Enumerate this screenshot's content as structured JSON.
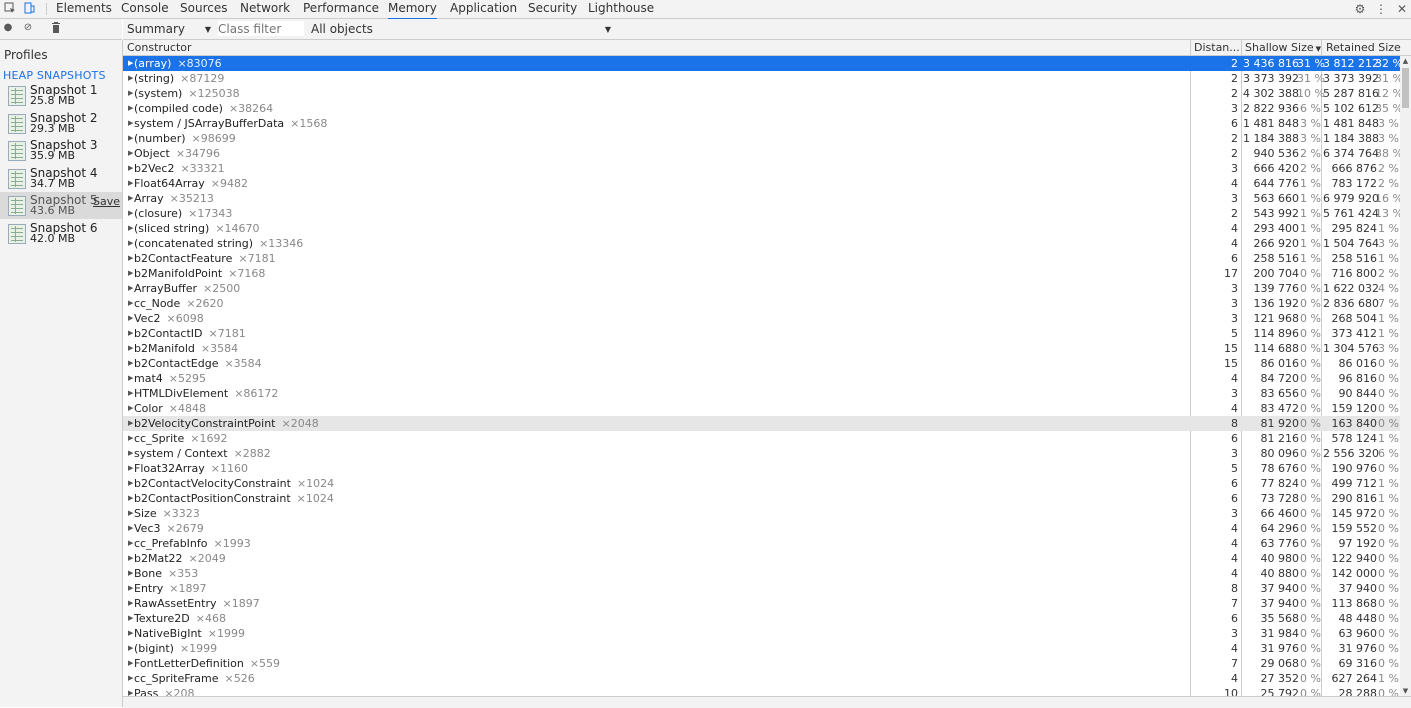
{
  "tabs": {
    "items": [
      "Elements",
      "Console",
      "Sources",
      "Network",
      "Performance",
      "Memory",
      "Application",
      "Security",
      "Lighthouse"
    ],
    "active_index": 5
  },
  "icons": {
    "inspect": "inspect-element-icon",
    "device": "device-toolbar-icon",
    "settings": "gear-icon",
    "more": "kebab-menu-icon",
    "close": "close-icon",
    "record": "record-icon",
    "clear": "clear-icon",
    "trash": "trash-icon"
  },
  "toolbar": {
    "view": "Summary",
    "class_filter_placeholder": "Class filter",
    "objects": "All objects"
  },
  "sidebar": {
    "title": "Profiles",
    "section": "HEAP SNAPSHOTS",
    "snapshots": [
      {
        "name": "Snapshot 1",
        "size": "25.8 MB"
      },
      {
        "name": "Snapshot 2",
        "size": "29.3 MB"
      },
      {
        "name": "Snapshot 3",
        "size": "35.9 MB"
      },
      {
        "name": "Snapshot 4",
        "size": "34.7 MB"
      },
      {
        "name": "Snapshot 5",
        "size": "43.6 MB",
        "save": "Save"
      },
      {
        "name": "Snapshot 6",
        "size": "42.0 MB"
      }
    ],
    "selected_index": 4
  },
  "grid": {
    "headers": {
      "constructor": "Constructor",
      "distance": "Distan...",
      "shallow": "Shallow Size",
      "retained": "Retained Size"
    },
    "sorted_column": "shallow",
    "selected_row": 0,
    "hovered_row": 24,
    "rows": [
      {
        "name": "(array)",
        "count": "×83076",
        "dist": "2",
        "shallow": "3 436 816",
        "spct": "31 %",
        "retained": "3 812 212",
        "rpct": "32 %"
      },
      {
        "name": "(string)",
        "count": "×87129",
        "dist": "2",
        "shallow": "3 373 392",
        "spct": "31 %",
        "retained": "3 373 392",
        "rpct": "31 %"
      },
      {
        "name": "(system)",
        "count": "×125038",
        "dist": "2",
        "shallow": "4 302 388",
        "spct": "10 %",
        "retained": "5 287 816",
        "rpct": "12 %"
      },
      {
        "name": "(compiled code)",
        "count": "×38264",
        "dist": "3",
        "shallow": "2 822 936",
        "spct": "6 %",
        "retained": "5 102 612",
        "rpct": "35 %"
      },
      {
        "name": "system / JSArrayBufferData",
        "count": "×1568",
        "dist": "6",
        "shallow": "1 481 848",
        "spct": "3 %",
        "retained": "1 481 848",
        "rpct": "3 %"
      },
      {
        "name": "(number)",
        "count": "×98699",
        "dist": "2",
        "shallow": "1 184 388",
        "spct": "3 %",
        "retained": "1 184 388",
        "rpct": "3 %"
      },
      {
        "name": "Object",
        "count": "×34796",
        "dist": "2",
        "shallow": "940 536",
        "spct": "2 %",
        "retained": "6 374 764",
        "rpct": "38 %"
      },
      {
        "name": "b2Vec2",
        "count": "×33321",
        "dist": "3",
        "shallow": "666 420",
        "spct": "2 %",
        "retained": "666 876",
        "rpct": "2 %"
      },
      {
        "name": "Float64Array",
        "count": "×9482",
        "dist": "4",
        "shallow": "644 776",
        "spct": "1 %",
        "retained": "783 172",
        "rpct": "2 %"
      },
      {
        "name": "Array",
        "count": "×35213",
        "dist": "3",
        "shallow": "563 660",
        "spct": "1 %",
        "retained": "6 979 920",
        "rpct": "16 %"
      },
      {
        "name": "(closure)",
        "count": "×17343",
        "dist": "2",
        "shallow": "543 992",
        "spct": "1 %",
        "retained": "5 761 424",
        "rpct": "13 %"
      },
      {
        "name": "(sliced string)",
        "count": "×14670",
        "dist": "4",
        "shallow": "293 400",
        "spct": "1 %",
        "retained": "295 824",
        "rpct": "1 %"
      },
      {
        "name": "(concatenated string)",
        "count": "×13346",
        "dist": "4",
        "shallow": "266 920",
        "spct": "1 %",
        "retained": "1 504 764",
        "rpct": "3 %"
      },
      {
        "name": "b2ContactFeature",
        "count": "×7181",
        "dist": "6",
        "shallow": "258 516",
        "spct": "1 %",
        "retained": "258 516",
        "rpct": "1 %"
      },
      {
        "name": "b2ManifoldPoint",
        "count": "×7168",
        "dist": "17",
        "shallow": "200 704",
        "spct": "0 %",
        "retained": "716 800",
        "rpct": "2 %"
      },
      {
        "name": "ArrayBuffer",
        "count": "×2500",
        "dist": "3",
        "shallow": "139 776",
        "spct": "0 %",
        "retained": "1 622 032",
        "rpct": "4 %"
      },
      {
        "name": "cc_Node",
        "count": "×2620",
        "dist": "3",
        "shallow": "136 192",
        "spct": "0 %",
        "retained": "2 836 680",
        "rpct": "7 %"
      },
      {
        "name": "Vec2",
        "count": "×6098",
        "dist": "3",
        "shallow": "121 968",
        "spct": "0 %",
        "retained": "268 504",
        "rpct": "1 %"
      },
      {
        "name": "b2ContactID",
        "count": "×7181",
        "dist": "5",
        "shallow": "114 896",
        "spct": "0 %",
        "retained": "373 412",
        "rpct": "1 %"
      },
      {
        "name": "b2Manifold",
        "count": "×3584",
        "dist": "15",
        "shallow": "114 688",
        "spct": "0 %",
        "retained": "1 304 576",
        "rpct": "3 %"
      },
      {
        "name": "b2ContactEdge",
        "count": "×3584",
        "dist": "15",
        "shallow": "86 016",
        "spct": "0 %",
        "retained": "86 016",
        "rpct": "0 %"
      },
      {
        "name": "mat4",
        "count": "×5295",
        "dist": "4",
        "shallow": "84 720",
        "spct": "0 %",
        "retained": "96 816",
        "rpct": "0 %"
      },
      {
        "name": "HTMLDivElement",
        "count": "×86172",
        "dist": "3",
        "shallow": "83 656",
        "spct": "0 %",
        "retained": "90 844",
        "rpct": "0 %"
      },
      {
        "name": "Color",
        "count": "×4848",
        "dist": "4",
        "shallow": "83 472",
        "spct": "0 %",
        "retained": "159 120",
        "rpct": "0 %"
      },
      {
        "name": "b2VelocityConstraintPoint",
        "count": "×2048",
        "dist": "8",
        "shallow": "81 920",
        "spct": "0 %",
        "retained": "163 840",
        "rpct": "0 %"
      },
      {
        "name": "cc_Sprite",
        "count": "×1692",
        "dist": "6",
        "shallow": "81 216",
        "spct": "0 %",
        "retained": "578 124",
        "rpct": "1 %"
      },
      {
        "name": "system / Context",
        "count": "×2882",
        "dist": "3",
        "shallow": "80 096",
        "spct": "0 %",
        "retained": "2 556 320",
        "rpct": "6 %"
      },
      {
        "name": "Float32Array",
        "count": "×1160",
        "dist": "5",
        "shallow": "78 676",
        "spct": "0 %",
        "retained": "190 976",
        "rpct": "0 %"
      },
      {
        "name": "b2ContactVelocityConstraint",
        "count": "×1024",
        "dist": "6",
        "shallow": "77 824",
        "spct": "0 %",
        "retained": "499 712",
        "rpct": "1 %"
      },
      {
        "name": "b2ContactPositionConstraint",
        "count": "×1024",
        "dist": "6",
        "shallow": "73 728",
        "spct": "0 %",
        "retained": "290 816",
        "rpct": "1 %"
      },
      {
        "name": "Size",
        "count": "×3323",
        "dist": "3",
        "shallow": "66 460",
        "spct": "0 %",
        "retained": "145 972",
        "rpct": "0 %"
      },
      {
        "name": "Vec3",
        "count": "×2679",
        "dist": "4",
        "shallow": "64 296",
        "spct": "0 %",
        "retained": "159 552",
        "rpct": "0 %"
      },
      {
        "name": "cc_PrefabInfo",
        "count": "×1993",
        "dist": "4",
        "shallow": "63 776",
        "spct": "0 %",
        "retained": "97 192",
        "rpct": "0 %"
      },
      {
        "name": "b2Mat22",
        "count": "×2049",
        "dist": "4",
        "shallow": "40 980",
        "spct": "0 %",
        "retained": "122 940",
        "rpct": "0 %"
      },
      {
        "name": "Bone",
        "count": "×353",
        "dist": "4",
        "shallow": "40 880",
        "spct": "0 %",
        "retained": "142 000",
        "rpct": "0 %"
      },
      {
        "name": "Entry",
        "count": "×1897",
        "dist": "8",
        "shallow": "37 940",
        "spct": "0 %",
        "retained": "37 940",
        "rpct": "0 %"
      },
      {
        "name": "RawAssetEntry",
        "count": "×1897",
        "dist": "7",
        "shallow": "37 940",
        "spct": "0 %",
        "retained": "113 868",
        "rpct": "0 %"
      },
      {
        "name": "Texture2D",
        "count": "×468",
        "dist": "6",
        "shallow": "35 568",
        "spct": "0 %",
        "retained": "48 448",
        "rpct": "0 %"
      },
      {
        "name": "NativeBigInt",
        "count": "×1999",
        "dist": "3",
        "shallow": "31 984",
        "spct": "0 %",
        "retained": "63 960",
        "rpct": "0 %"
      },
      {
        "name": "(bigint)",
        "count": "×1999",
        "dist": "4",
        "shallow": "31 976",
        "spct": "0 %",
        "retained": "31 976",
        "rpct": "0 %"
      },
      {
        "name": "FontLetterDefinition",
        "count": "×559",
        "dist": "7",
        "shallow": "29 068",
        "spct": "0 %",
        "retained": "69 316",
        "rpct": "0 %"
      },
      {
        "name": "cc_SpriteFrame",
        "count": "×526",
        "dist": "4",
        "shallow": "27 352",
        "spct": "0 %",
        "retained": "627 264",
        "rpct": "1 %"
      },
      {
        "name": "Pass",
        "count": "×208",
        "dist": "10",
        "shallow": "25 792",
        "spct": "0 %",
        "retained": "28 288",
        "rpct": "0 %"
      }
    ]
  },
  "colors": {
    "accent": "#1a73e8",
    "selected_row": "#1a73e8",
    "hover_row": "#e6e6e6",
    "panel_bg": "#f3f3f3"
  }
}
